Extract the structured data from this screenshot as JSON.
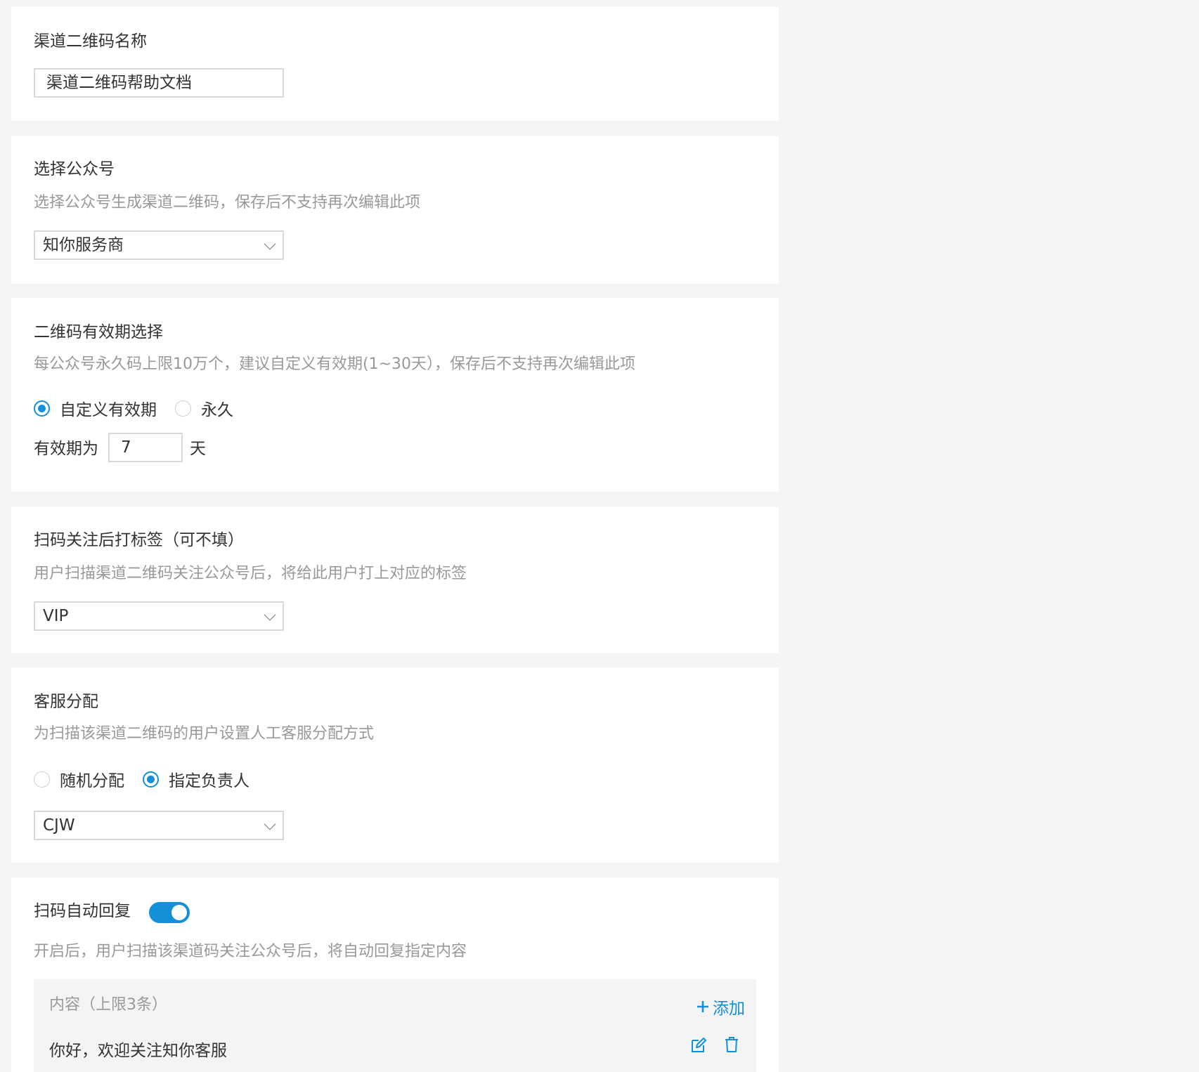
{
  "name_section": {
    "title": "渠道二维码名称",
    "value": "渠道二维码帮助文档"
  },
  "account_section": {
    "title": "选择公众号",
    "desc": "选择公众号生成渠道二维码，保存后不支持再次编辑此项",
    "selected": "知你服务商"
  },
  "validity_section": {
    "title": "二维码有效期选择",
    "desc": "每公众号永久码上限10万个，建议自定义有效期(1~30天），保存后不支持再次编辑此项",
    "options": [
      {
        "label": "自定义有效期",
        "checked": true
      },
      {
        "label": "永久",
        "checked": false
      }
    ],
    "prefix": "有效期为",
    "days": "7",
    "suffix": "天"
  },
  "tag_section": {
    "title": "扫码关注后打标签（可不填）",
    "desc": "用户扫描渠道二维码关注公众号后，将给此用户打上对应的标签",
    "selected": "VIP"
  },
  "service_section": {
    "title": "客服分配",
    "desc": "为扫描该渠道二维码的用户设置人工客服分配方式",
    "options": [
      {
        "label": "随机分配",
        "checked": false
      },
      {
        "label": "指定负责人",
        "checked": true
      }
    ],
    "selected": "CJW"
  },
  "reply_section": {
    "title": "扫码自动回复",
    "toggle_on": true,
    "desc": "开启后，用户扫描该渠道码关注公众号后，将自动回复指定内容",
    "content_label": "内容（上限3条）",
    "add_label": "添加",
    "items": [
      "你好，欢迎关注知你客服"
    ]
  },
  "colors": {
    "accent": "#1490d8",
    "muted": "#999999",
    "background": "#f5f5f5"
  }
}
